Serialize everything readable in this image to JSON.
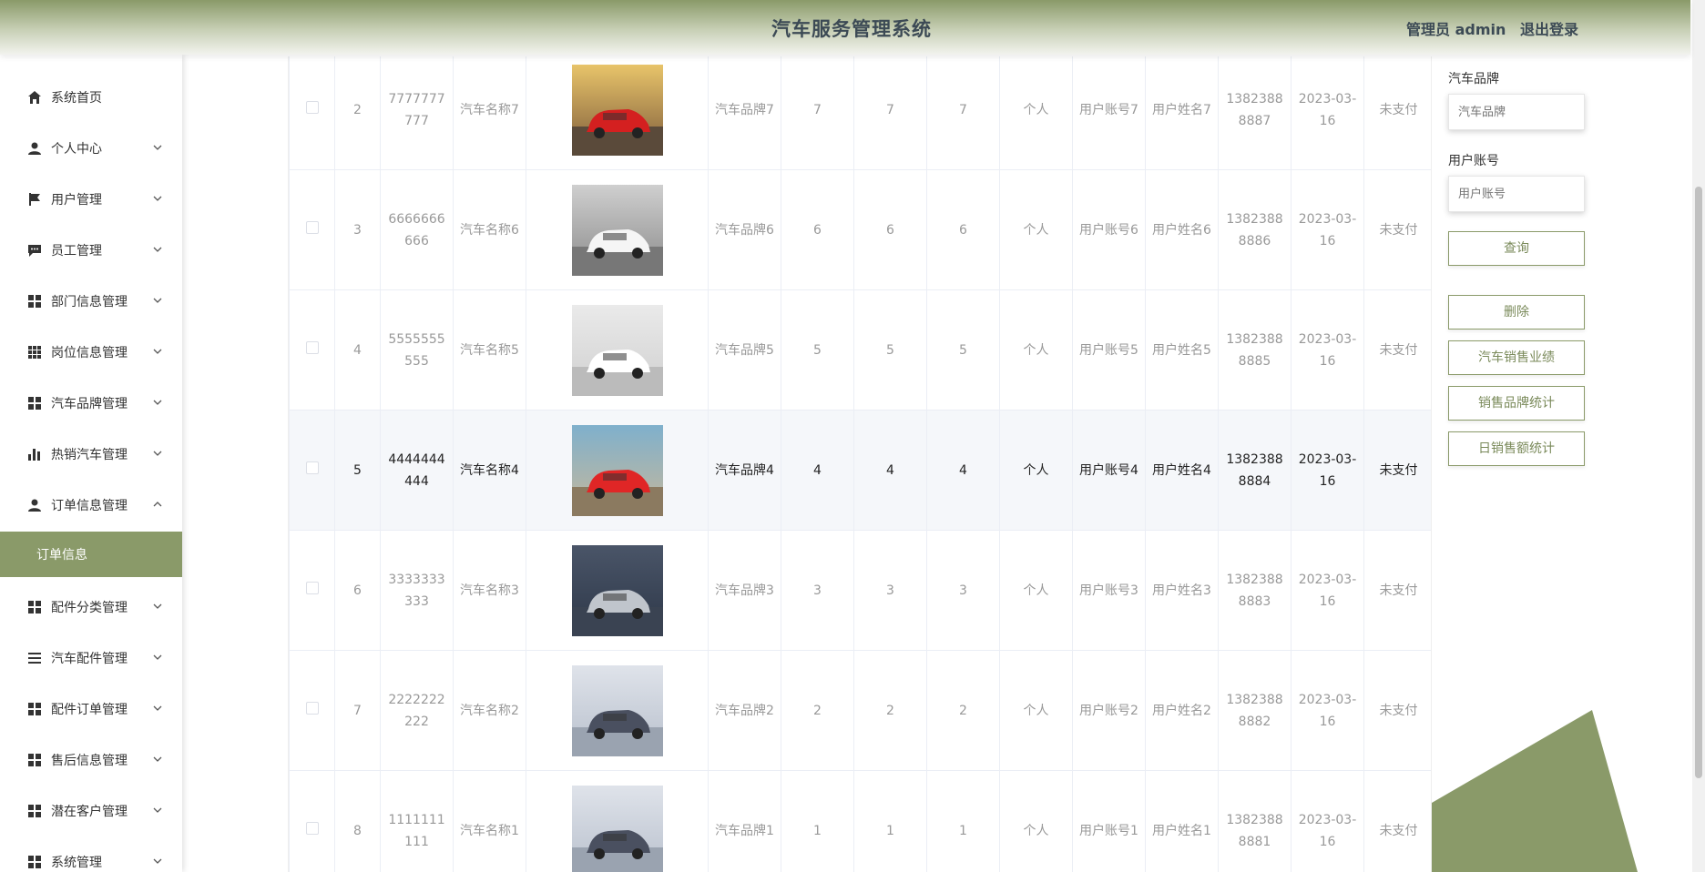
{
  "header": {
    "title": "汽车服务管理系统",
    "user": "管理员 admin",
    "logout": "退出登录"
  },
  "sidebar": {
    "items": [
      {
        "label": "系统首页",
        "icon": "home-icon"
      },
      {
        "label": "个人中心",
        "icon": "user-icon"
      },
      {
        "label": "用户管理",
        "icon": "flag-icon"
      },
      {
        "label": "员工管理",
        "icon": "chat-icon"
      },
      {
        "label": "部门信息管理",
        "icon": "grid-icon"
      },
      {
        "label": "岗位信息管理",
        "icon": "apps-icon"
      },
      {
        "label": "汽车品牌管理",
        "icon": "grid-icon"
      },
      {
        "label": "热销汽车管理",
        "icon": "bar-chart-icon"
      },
      {
        "label": "订单信息管理",
        "icon": "user-icon"
      },
      {
        "label": "配件分类管理",
        "icon": "grid-icon"
      },
      {
        "label": "汽车配件管理",
        "icon": "list-icon"
      },
      {
        "label": "配件订单管理",
        "icon": "grid-icon"
      },
      {
        "label": "售后信息管理",
        "icon": "grid-icon"
      },
      {
        "label": "潜在客户管理",
        "icon": "grid-icon"
      },
      {
        "label": "系统管理",
        "icon": "grid-icon"
      }
    ],
    "active_sub": "订单信息"
  },
  "table": {
    "rows": [
      {
        "idx": "2",
        "order_no": "7777777777",
        "car_name": "汽车名称7",
        "brand": "汽车品牌7",
        "c1": "7",
        "c2": "7",
        "c3": "7",
        "type": "个人",
        "account": "用户账号7",
        "uname": "用户姓名7",
        "phone": "13823888887",
        "date": "2023-03-16",
        "status": "未支付"
      },
      {
        "idx": "3",
        "order_no": "6666666666",
        "car_name": "汽车名称6",
        "brand": "汽车品牌6",
        "c1": "6",
        "c2": "6",
        "c3": "6",
        "type": "个人",
        "account": "用户账号6",
        "uname": "用户姓名6",
        "phone": "13823888886",
        "date": "2023-03-16",
        "status": "未支付"
      },
      {
        "idx": "4",
        "order_no": "5555555555",
        "car_name": "汽车名称5",
        "brand": "汽车品牌5",
        "c1": "5",
        "c2": "5",
        "c3": "5",
        "type": "个人",
        "account": "用户账号5",
        "uname": "用户姓名5",
        "phone": "13823888885",
        "date": "2023-03-16",
        "status": "未支付"
      },
      {
        "idx": "5",
        "order_no": "4444444444",
        "car_name": "汽车名称4",
        "brand": "汽车品牌4",
        "c1": "4",
        "c2": "4",
        "c3": "4",
        "type": "个人",
        "account": "用户账号4",
        "uname": "用户姓名4",
        "phone": "13823888884",
        "date": "2023-03-16",
        "status": "未支付"
      },
      {
        "idx": "6",
        "order_no": "3333333333",
        "car_name": "汽车名称3",
        "brand": "汽车品牌3",
        "c1": "3",
        "c2": "3",
        "c3": "3",
        "type": "个人",
        "account": "用户账号3",
        "uname": "用户姓名3",
        "phone": "13823888883",
        "date": "2023-03-16",
        "status": "未支付"
      },
      {
        "idx": "7",
        "order_no": "2222222222",
        "car_name": "汽车名称2",
        "brand": "汽车品牌2",
        "c1": "2",
        "c2": "2",
        "c3": "2",
        "type": "个人",
        "account": "用户账号2",
        "uname": "用户姓名2",
        "phone": "13823888882",
        "date": "2023-03-16",
        "status": "未支付"
      },
      {
        "idx": "8",
        "order_no": "1111111111",
        "car_name": "汽车名称1",
        "brand": "汽车品牌1",
        "c1": "1",
        "c2": "1",
        "c3": "1",
        "type": "个人",
        "account": "用户账号1",
        "uname": "用户姓名1",
        "phone": "13823888881",
        "date": "2023-03-16",
        "status": "未支付"
      }
    ]
  },
  "search": {
    "brand_label": "汽车品牌",
    "brand_placeholder": "汽车品牌",
    "account_label": "用户账号",
    "account_placeholder": "用户账号",
    "query_btn": "查询",
    "delete_btn": "删除",
    "sales_btn": "汽车销售业绩",
    "brand_stat_btn": "销售品牌统计",
    "daily_stat_btn": "日销售额统计"
  },
  "colors": {
    "accent": "#8a9a69",
    "header_text": "#3c4a55"
  }
}
